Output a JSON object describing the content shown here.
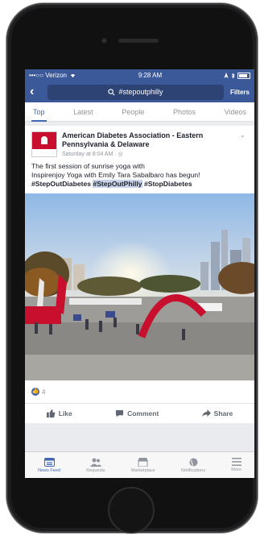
{
  "status_bar": {
    "carrier": "•••○○ Verizon",
    "time": "9:28 AM"
  },
  "nav": {
    "search_query": "#stepoutphilly",
    "filters_label": "Filters"
  },
  "tabs": [
    {
      "label": "Top",
      "active": true
    },
    {
      "label": "Latest"
    },
    {
      "label": "People"
    },
    {
      "label": "Photos"
    },
    {
      "label": "Videos"
    }
  ],
  "post": {
    "author": "American Diabetes Association - Eastern Pennsylvania & Delaware",
    "time": "Saturday at 8:04 AM · ",
    "text_line1": "The first session of sunrise yoga with",
    "text_line2": "Inspirenjoy Yoga with Emily Tara Sabalbaro has begun!",
    "hashtag1": "#StepOutDiabetes",
    "hashtag2": "#StepOutPhilly",
    "hashtag3": "#StopDiabetes",
    "like_count": "4",
    "actions": {
      "like": "Like",
      "comment": "Comment",
      "share": "Share"
    }
  },
  "bottom_nav": [
    {
      "label": "News Feed",
      "icon": "news-feed-icon",
      "active": true
    },
    {
      "label": "Requests",
      "icon": "requests-icon"
    },
    {
      "label": "Marketplace",
      "icon": "marketplace-icon"
    },
    {
      "label": "Notifications",
      "icon": "globe-icon"
    },
    {
      "label": "More",
      "icon": "menu-icon"
    }
  ],
  "colors": {
    "facebook_blue": "#3b5998",
    "link_blue": "#4267b2",
    "ada_red": "#c8102e"
  }
}
